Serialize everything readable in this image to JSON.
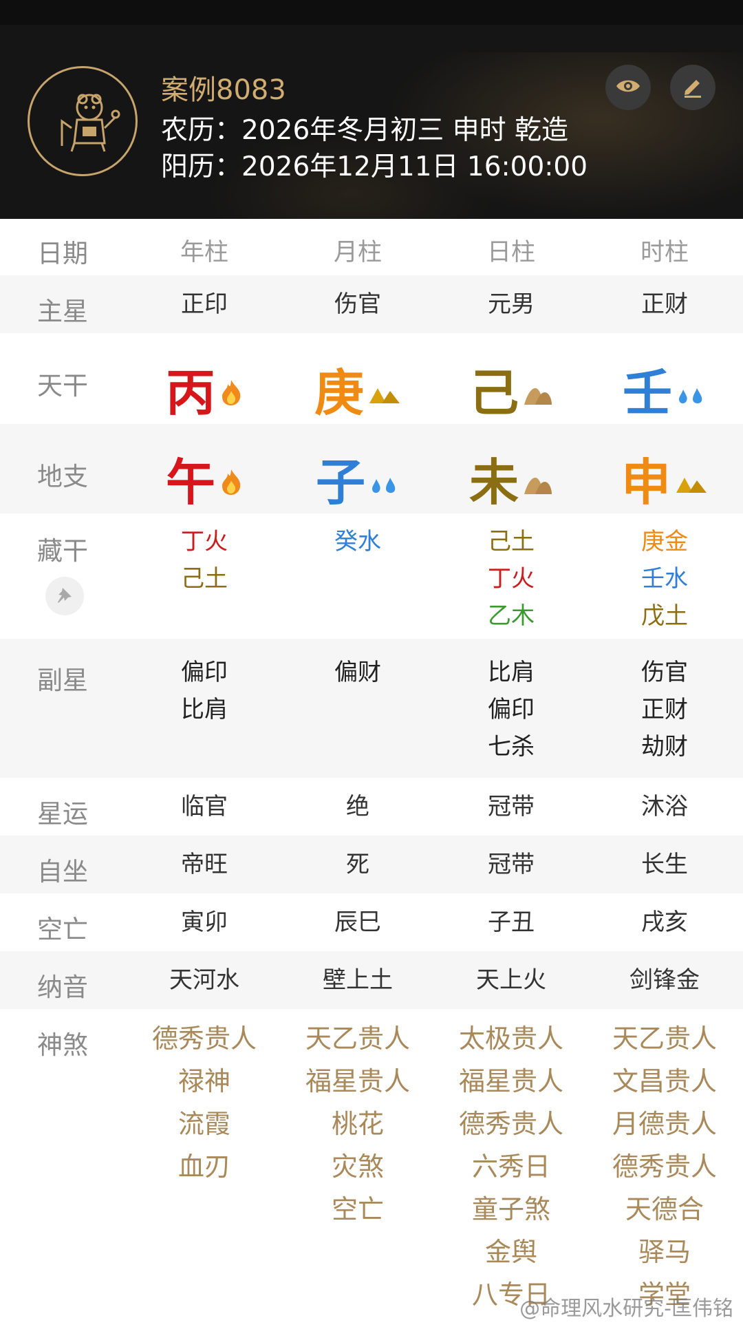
{
  "header": {
    "case_title": "案例8083",
    "lunar": "农历：2026年冬月初三 申时 乾造",
    "solar": "阳历：2026年12月11日 16:00:00",
    "view_icon": "eye-icon",
    "edit_icon": "pencil-icon",
    "avatar_icon": "zodiac-rat-icon"
  },
  "columns": [
    "年柱",
    "月柱",
    "日柱",
    "时柱"
  ],
  "labels": {
    "date": "日期",
    "main_star": "主星",
    "stem": "天干",
    "branch": "地支",
    "hidden": "藏干",
    "sub_star": "副星",
    "star_luck": "星运",
    "self_sit": "自坐",
    "void": "空亡",
    "nayin": "纳音",
    "shensha": "神煞"
  },
  "main_star": [
    "正印",
    "伤官",
    "元男",
    "正财"
  ],
  "stems": [
    {
      "char": "丙",
      "color": "#d6161b",
      "element_icon": "fire-icon"
    },
    {
      "char": "庚",
      "color": "#ef8a13",
      "element_icon": "metal-icon"
    },
    {
      "char": "己",
      "color": "#8b6d12",
      "element_icon": "earth-icon"
    },
    {
      "char": "壬",
      "color": "#2f7fd6",
      "element_icon": "water-icon"
    }
  ],
  "branches": [
    {
      "char": "午",
      "color": "#d6161b",
      "element_icon": "fire-icon"
    },
    {
      "char": "子",
      "color": "#2f7fd6",
      "element_icon": "water-icon"
    },
    {
      "char": "未",
      "color": "#8b6d12",
      "element_icon": "earth-icon"
    },
    {
      "char": "申",
      "color": "#ef8a13",
      "element_icon": "metal-icon"
    }
  ],
  "hidden_stems": [
    [
      {
        "text": "丁火",
        "color": "#c81e1e"
      },
      {
        "text": "己土",
        "color": "#8b6d12"
      }
    ],
    [
      {
        "text": "癸水",
        "color": "#2f7fd6"
      }
    ],
    [
      {
        "text": "己土",
        "color": "#8b6d12"
      },
      {
        "text": "丁火",
        "color": "#c81e1e"
      },
      {
        "text": "乙木",
        "color": "#3a9a2e"
      }
    ],
    [
      {
        "text": "庚金",
        "color": "#ef8a13"
      },
      {
        "text": "壬水",
        "color": "#2f7fd6"
      },
      {
        "text": "戊土",
        "color": "#8b6d12"
      }
    ]
  ],
  "pin_icon": "pin-icon",
  "sub_stars": [
    [
      "偏印",
      "比肩"
    ],
    [
      "偏财"
    ],
    [
      "比肩",
      "偏印",
      "七杀"
    ],
    [
      "伤官",
      "正财",
      "劫财"
    ]
  ],
  "star_luck": [
    "临官",
    "绝",
    "冠带",
    "沐浴"
  ],
  "self_sit": [
    "帝旺",
    "死",
    "冠带",
    "长生"
  ],
  "void": [
    "寅卯",
    "辰巳",
    "子丑",
    "戌亥"
  ],
  "nayin": [
    "天河水",
    "壁上土",
    "天上火",
    "剑锋金"
  ],
  "shensha": [
    [
      "德秀贵人",
      "禄神",
      "流霞",
      "血刃"
    ],
    [
      "天乙贵人",
      "福星贵人",
      "桃花",
      "灾煞",
      "空亡"
    ],
    [
      "太极贵人",
      "福星贵人",
      "德秀贵人",
      "六秀日",
      "童子煞",
      "金舆",
      "八专日"
    ],
    [
      "天乙贵人",
      "文昌贵人",
      "月德贵人",
      "德秀贵人",
      "天德合",
      "驿马",
      "学堂"
    ]
  ],
  "watermark": "@命理风水研究-匡伟铭"
}
